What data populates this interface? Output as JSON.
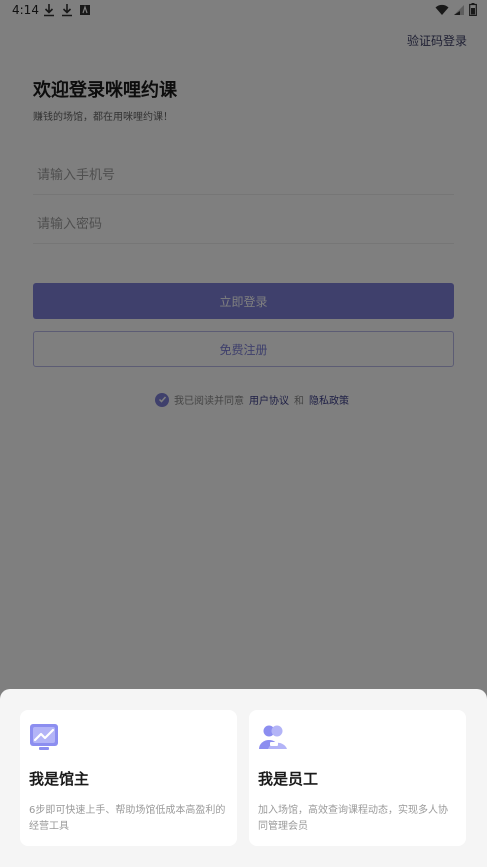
{
  "status_bar": {
    "time": "4:14"
  },
  "header": {
    "sms_login": "验证码登录"
  },
  "welcome": {
    "title": "欢迎登录咪哩约课",
    "subtitle": "赚钱的场馆，都在用咪哩约课！"
  },
  "form": {
    "phone_placeholder": "请输入手机号",
    "password_placeholder": "请输入密码",
    "login_label": "立即登录",
    "register_label": "免费注册"
  },
  "agreement": {
    "prefix": "我已阅读并同意",
    "user_agreement": "用户协议",
    "and": "和",
    "privacy_policy": "隐私政策"
  },
  "sheet": {
    "owner": {
      "title": "我是馆主",
      "desc": "6步即可快速上手、帮助场馆低成本高盈利的经营工具"
    },
    "staff": {
      "title": "我是员工",
      "desc": "加入场馆，高效查询课程动态，实现多人协同管理会员"
    }
  },
  "colors": {
    "accent": "#7e80d8",
    "link": "#3d3f8a"
  },
  "icons": [
    "download-icon",
    "download-icon",
    "font-icon",
    "wifi-icon",
    "signal-icon",
    "battery-icon",
    "check-circle-icon",
    "chart-icon",
    "user-group-icon"
  ]
}
